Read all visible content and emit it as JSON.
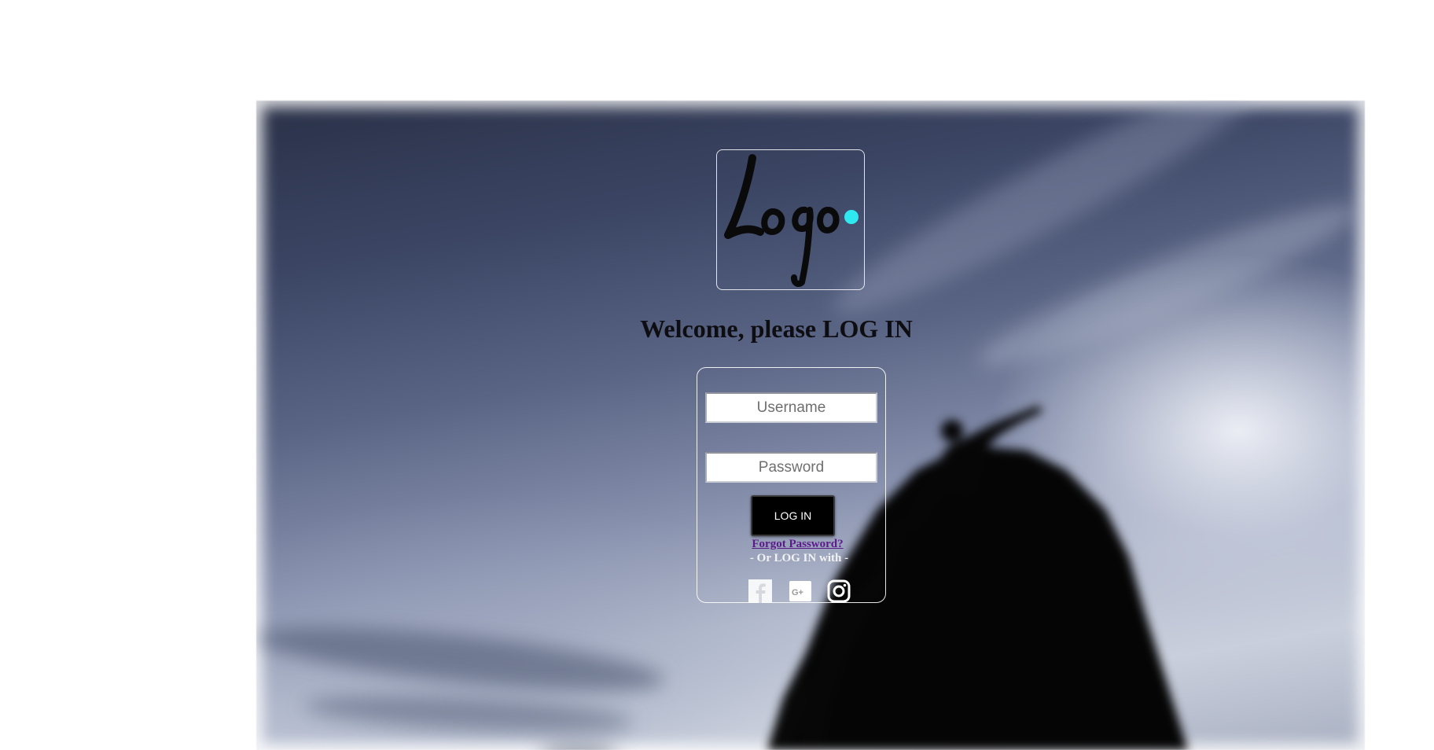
{
  "logo": {
    "text": "Logo",
    "accent_color": "#2fe9f0"
  },
  "welcome": {
    "title": "Welcome, please LOG IN"
  },
  "form": {
    "username_placeholder": "Username",
    "password_placeholder": "Password",
    "login_label": "LOG IN",
    "forgot_label": "Forgot Password?",
    "alt_label": "- Or LOG IN with -"
  },
  "social": {
    "icons": [
      "facebook-icon",
      "google-plus-icon",
      "instagram-icon"
    ]
  }
}
